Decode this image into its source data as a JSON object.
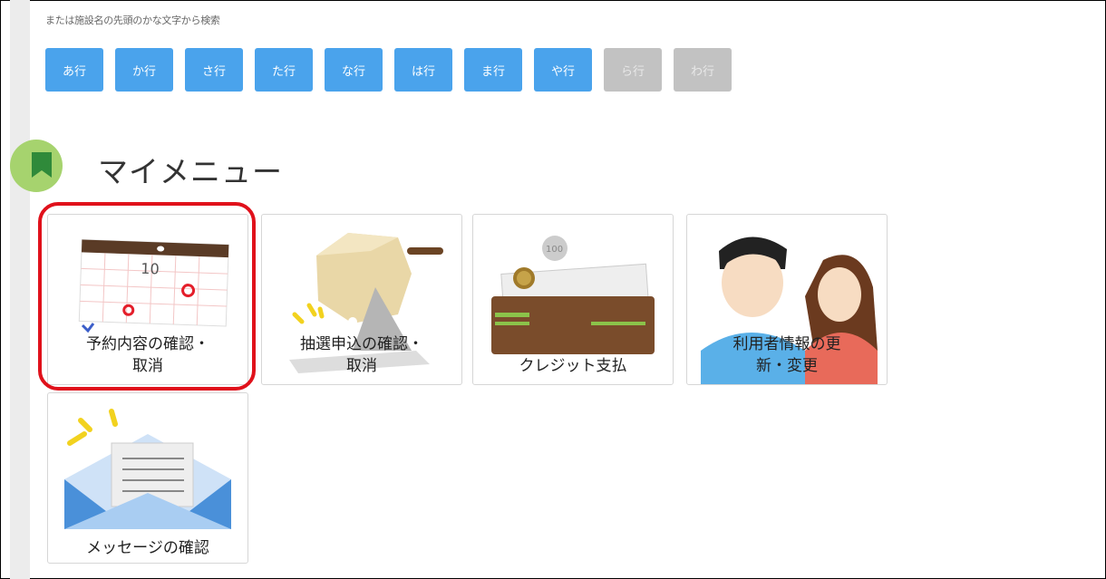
{
  "search": {
    "hint": "または施設名の先頭のかな文字から検索",
    "kana_buttons": [
      {
        "label": "あ行",
        "enabled": true
      },
      {
        "label": "か行",
        "enabled": true
      },
      {
        "label": "さ行",
        "enabled": true
      },
      {
        "label": "た行",
        "enabled": true
      },
      {
        "label": "な行",
        "enabled": true
      },
      {
        "label": "は行",
        "enabled": true
      },
      {
        "label": "ま行",
        "enabled": true
      },
      {
        "label": "や行",
        "enabled": true
      },
      {
        "label": "ら行",
        "enabled": false
      },
      {
        "label": "わ行",
        "enabled": false
      }
    ]
  },
  "mymenu": {
    "title": "マイメニュー",
    "icon": "bookmark-icon",
    "items": [
      {
        "line1": "予約内容の確認・",
        "line2": "取消",
        "icon": "calendar-icon"
      },
      {
        "line1": "抽選申込の確認・",
        "line2": "取消",
        "icon": "lottery-drum-icon"
      },
      {
        "line1": "クレジット支払",
        "line2": "",
        "icon": "wallet-icon"
      },
      {
        "line1": "利用者情報の更",
        "line2": "新・変更",
        "icon": "users-icon"
      },
      {
        "line1": "メッセージの確認",
        "line2": "",
        "icon": "envelope-icon"
      }
    ],
    "calendar_number": "10",
    "coin_label": "100"
  },
  "colors": {
    "kana_enabled": "#4aa3ec",
    "kana_disabled": "#c2c2c2",
    "highlight": "#e0111b",
    "section_icon": "#a6d36e",
    "bookmark": "#2f8a3a"
  }
}
